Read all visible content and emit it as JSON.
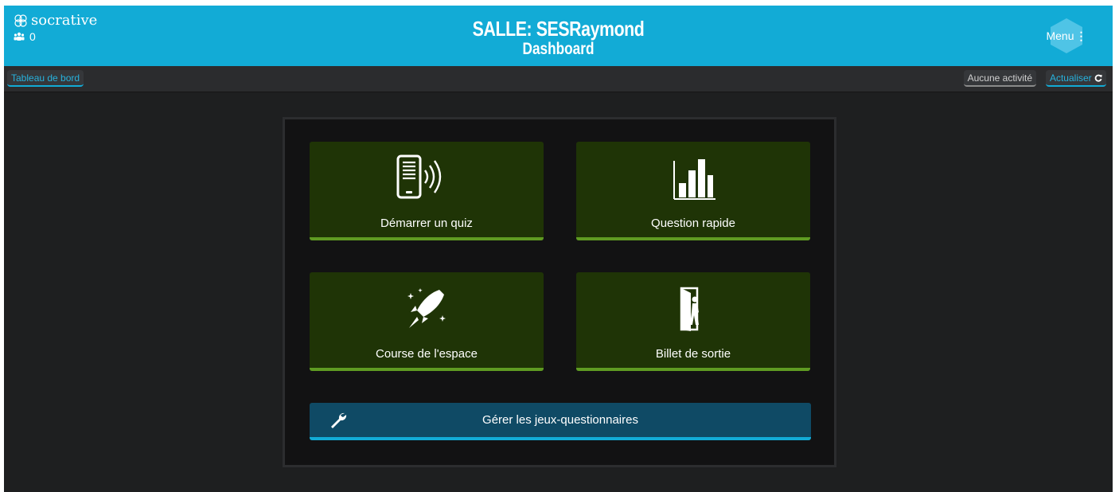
{
  "header": {
    "brand": "socrative",
    "student_count": "0",
    "room_title": "SALLE: SESRaymond",
    "subtitle": "Dashboard",
    "menu_label": "Menu",
    "menu_dots": "⋮"
  },
  "toolbar": {
    "dashboard_label": "Tableau de bord",
    "activity_status": "Aucune activité",
    "refresh_label": "Actualiser"
  },
  "tiles": [
    {
      "label": "Démarrer un quiz",
      "icon": "tablet-broadcast-icon"
    },
    {
      "label": "Question rapide",
      "icon": "bar-chart-icon"
    },
    {
      "label": "Course de l'espace",
      "icon": "rocket-icon"
    },
    {
      "label": "Billet de sortie",
      "icon": "exit-door-icon"
    }
  ],
  "manage": {
    "label": "Gérer les jeux-questionnaires",
    "icon": "wrench-icon"
  },
  "colors": {
    "header_blue": "#12abd6",
    "tile_green": "#1f3406",
    "tile_accent": "#5f9b22",
    "manage_blue": "#0f4a65"
  }
}
